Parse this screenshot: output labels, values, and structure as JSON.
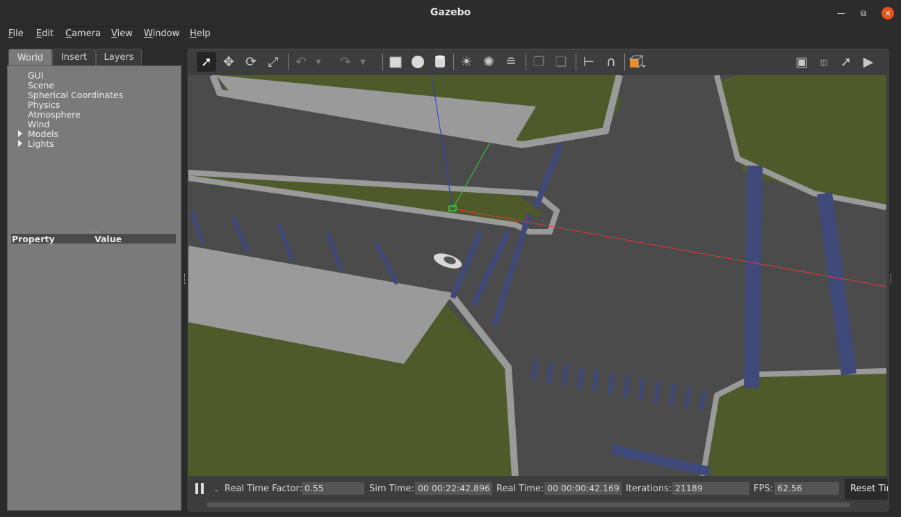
{
  "window": {
    "title": "Gazebo"
  },
  "menu": [
    {
      "key": "F",
      "rest": "ile"
    },
    {
      "key": "E",
      "rest": "dit"
    },
    {
      "key": "C",
      "rest": "amera"
    },
    {
      "key": "V",
      "rest": "iew"
    },
    {
      "key": "W",
      "rest": "indow"
    },
    {
      "key": "H",
      "rest": "elp"
    }
  ],
  "left_panel": {
    "tabs": [
      "World",
      "Insert",
      "Layers"
    ],
    "active_tab": "World",
    "tree": [
      "GUI",
      "Scene",
      "Spherical Coordinates",
      "Physics",
      "Atmosphere",
      "Wind",
      "Models",
      "Lights"
    ],
    "expandable": [
      "Models",
      "Lights"
    ],
    "property_header": {
      "property": "Property",
      "value": "Value"
    }
  },
  "toolbar": {
    "tools": [
      "select-mode",
      "translate-mode",
      "rotate-mode",
      "scale-mode",
      "undo",
      "undo-history",
      "redo",
      "redo-history",
      "box",
      "sphere",
      "cylinder",
      "point-light",
      "spot-light",
      "directional-light",
      "copy",
      "paste",
      "align",
      "snap",
      "view-angle"
    ],
    "active": "select-mode",
    "right_tools": [
      "screenshot",
      "log",
      "plot",
      "record-video"
    ]
  },
  "scene_colors": {
    "grass": "#4e5a2a",
    "road": "#4b4b4b",
    "curb": "#9a9a9a",
    "lane": "#3f4a7a",
    "axis_x": "#e23b3b",
    "axis_y": "#3ad13a",
    "axis_z": "#2a3ad8"
  },
  "status": {
    "real_time_factor_label": "Real Time Factor:",
    "real_time_factor": "0.55",
    "sim_time_label": "Sim Time:",
    "sim_time": "00 00:22:42.896",
    "real_time_label": "Real Time:",
    "real_time": "00 00:00:42.169",
    "iterations_label": "Iterations:",
    "iterations": "21189",
    "fps_label": "FPS:",
    "fps": "62.56",
    "reset_label": "Reset Time",
    "step_indicator": "-"
  }
}
